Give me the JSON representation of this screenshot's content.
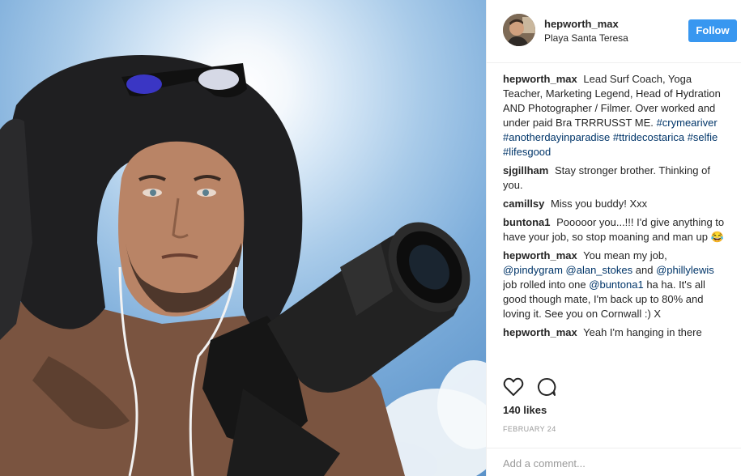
{
  "header": {
    "username": "hepworth_max",
    "location": "Playa Santa Teresa",
    "follow_label": "Follow"
  },
  "caption": {
    "author": "hepworth_max",
    "text": "Lead Surf Coach, Yoga Teacher, Marketing Legend, Head of Hydration AND Photographer / Filmer. Over worked and under paid Bra TRRRUSST ME.",
    "hashtags": [
      "#crymeariver",
      "#anotherdayinparadise",
      "#ttridecostarica",
      "#selfie",
      "#lifesgood"
    ]
  },
  "comments": [
    {
      "author": "sjgillham",
      "text": "Stay stronger brother. Thinking of you."
    },
    {
      "author": "camillsy",
      "text": "Miss you buddy! Xxx"
    },
    {
      "author": "buntona1",
      "text": "Pooooor you...!!! I'd give anything to have your job, so stop moaning and man up 😂"
    },
    {
      "author": "hepworth_max",
      "text_before": "You mean my job,",
      "mention_1": "@pindygram",
      "mention_2": "@alan_stokes",
      "and": "and",
      "mention_3": "@phillylewis",
      "text_middle": "job rolled into one",
      "mention_4": "@buntona1",
      "text_after": "ha ha. It's all good though mate, I'm back up to 80% and loving it. See you on Cornwall :) X"
    },
    {
      "author": "hepworth_max",
      "text": "Yeah I'm hanging in there"
    }
  ],
  "actions": {
    "like_icon": "heart-icon",
    "comment_icon": "speech-bubble-icon"
  },
  "likes": "140 likes",
  "date": "FEBRUARY 24",
  "add_comment": {
    "placeholder": "Add a comment..."
  },
  "colors": {
    "follow_button": "#3897f0",
    "hashtag": "#003569",
    "meta_text": "#999999"
  }
}
